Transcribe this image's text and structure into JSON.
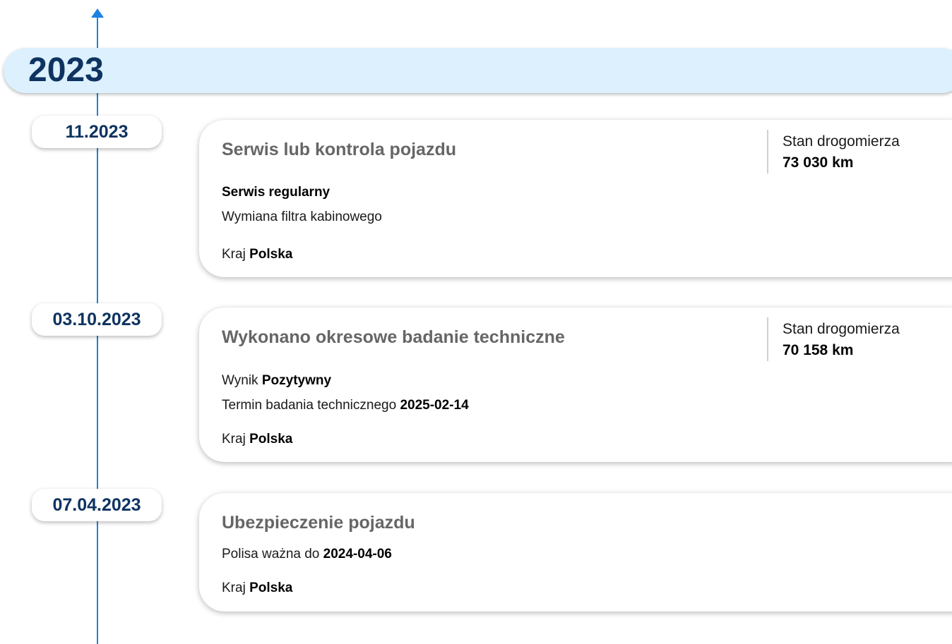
{
  "year": "2023",
  "events": [
    {
      "date": "11.2023",
      "title": "Serwis lub kontrola pojazdu",
      "odometer_label": "Stan drogomierza",
      "odometer_value": "73 030 km",
      "line1_bold": "Serwis regularny",
      "line2": "Wymiana filtra kabinowego",
      "country_label": "Kraj",
      "country_value": "Polska"
    },
    {
      "date": "03.10.2023",
      "title": "Wykonano okresowe badanie techniczne",
      "odometer_label": "Stan drogomierza",
      "odometer_value": "70 158 km",
      "result_label": "Wynik",
      "result_value": "Pozytywny",
      "term_label": "Termin badania technicznego",
      "term_value": "2025-02-14",
      "country_label": "Kraj",
      "country_value": "Polska"
    },
    {
      "date": "07.04.2023",
      "title": "Ubezpieczenie pojazdu",
      "policy_label": "Polisa ważna do",
      "policy_value": "2024-04-06",
      "country_label": "Kraj",
      "country_value": "Polska"
    }
  ],
  "colors": {
    "timeline": "#1a82e2",
    "year_bar": "#dcf1fd",
    "heading": "#0e3361",
    "card_title": "#666666"
  }
}
